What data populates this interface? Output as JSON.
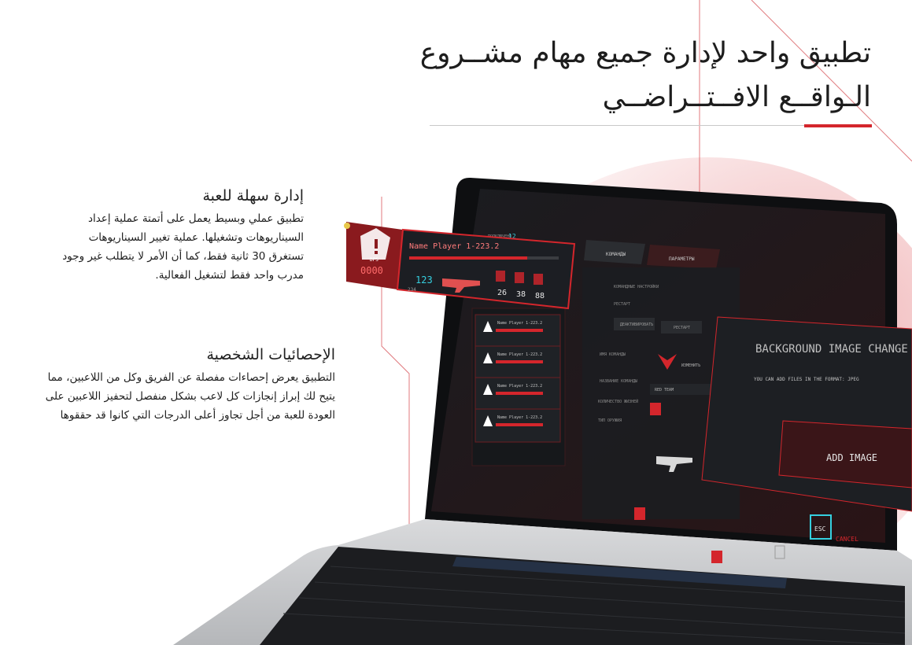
{
  "title": "تطبيق واحد لإدارة جميع مهام مشــروع الـواقــع الافــتــراضــي",
  "features": [
    {
      "heading": "إدارة سهلة للعبة",
      "body": "تطبيق عملي وبسيط يعمل على أتمتة عملية إعداد السيناريوهات وتشغيلها. عملية تغيير السيناريوهات تستغرق 30 ثانية فقط، كما أن الأمر لا يتطلب غير وجود مدرب واحد فقط لتشغيل الفعالية."
    },
    {
      "heading": "الإحصائيات الشخصية",
      "body": "التطبيق يعرض إحصاءات مفصلة عن الفريق وكل من اللاعبين، مما يتيح لك إبراز إنجازات كل لاعب بشكل منفصل لتحفيز اللاعبين على العودة للعبة من أجل تجاوز أعلى الدرجات التي كانوا قد حققوها"
    }
  ],
  "app_ui": {
    "player_card": {
      "name": "Name Player 1-223.2",
      "dps_label": "DPS",
      "dps_value": "0000",
      "ammo": "123",
      "ammo_sub": "234",
      "stats": [
        "26",
        "38",
        "88"
      ]
    },
    "player_list": [
      {
        "name": "Name Player 1-223.2"
      },
      {
        "name": "Name Player 1-223.2"
      },
      {
        "name": "Name Player 1-223.2"
      },
      {
        "name": "Name Player 1-223.2"
      }
    ],
    "players_count": "12",
    "tabs": [
      "КОМАНДЫ",
      "ПАРАМЕТРЫ"
    ],
    "settings_title": "КОМАНДНЫЕ НАСТРОЙКИ",
    "rows": [
      "РЕСТАРТ",
      "ДЕАКТИВИРОВАТЬ",
      "РЕСТАРТ",
      "ИМЯ КОМАНДЫ",
      "НАЗВАНИЕ КОМАНДЫ",
      "КОЛИЧЕСТВО ЖИЗНЕЙ",
      "ТИП ОРУЖИЯ"
    ],
    "rename_label": "ИЗМЕНИТЬ",
    "team_value": "RED TEAM",
    "dialog": {
      "title": "BACKGROUND IMAGE CHANGE",
      "subtitle": "YOU CAN ADD FILES IN THE FORMAT: JPEG",
      "button": "ADD IMAGE",
      "esc": "ESC",
      "cancel": "CANCEL"
    }
  },
  "colors": {
    "accent_red": "#d4262c",
    "dark_ui": "#1b1d22",
    "glow_cyan": "#35d0e0"
  }
}
